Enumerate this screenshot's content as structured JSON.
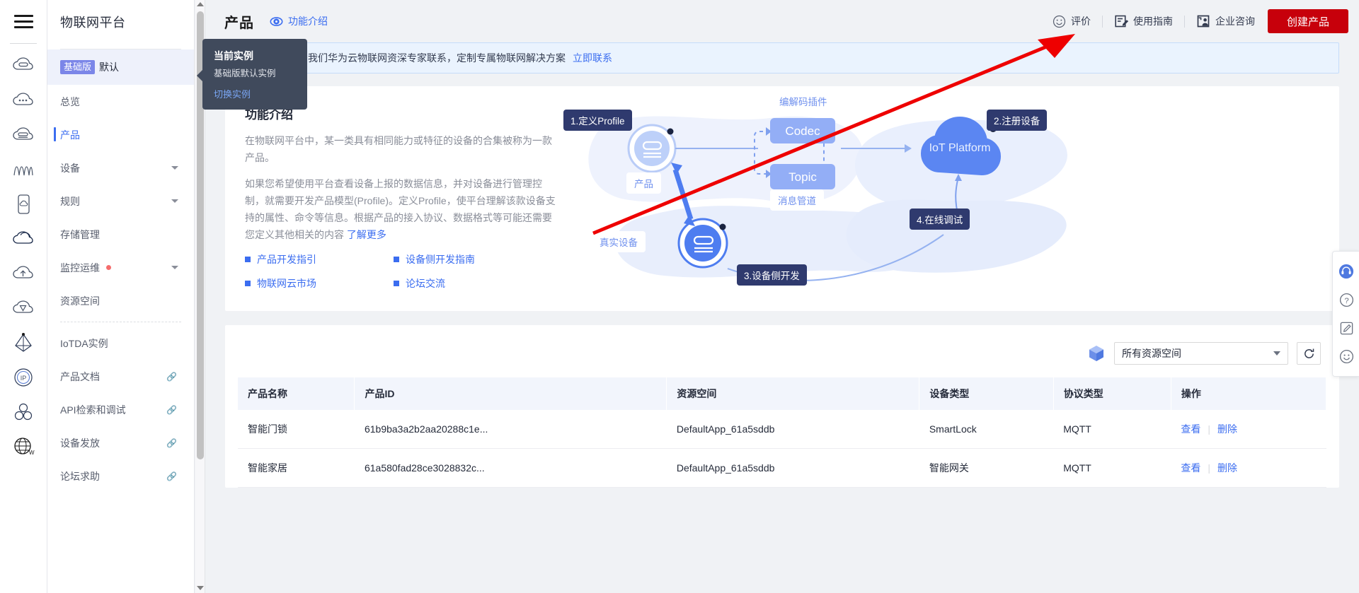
{
  "rail": {
    "menu_icon": "hamburger-menu-icon",
    "icons": [
      {
        "name": "cloud-server-icon"
      },
      {
        "name": "cloud-dots-icon"
      },
      {
        "name": "cloud-database-icon"
      },
      {
        "name": "wave-chart-icon"
      },
      {
        "name": "mobile-cloud-icon"
      },
      {
        "name": "cloud-stack-icon"
      },
      {
        "name": "cloud-upload-icon"
      },
      {
        "name": "cloud-play-icon"
      },
      {
        "name": "pyramid-icon"
      },
      {
        "name": "ip-circle-icon"
      },
      {
        "name": "molecule-icon"
      },
      {
        "name": "globe-w-icon"
      }
    ]
  },
  "sidebar": {
    "title": "物联网平台",
    "instance": {
      "badge": "基础版",
      "name": "默认"
    },
    "items": [
      {
        "label": "总览",
        "active": false,
        "caret": false,
        "dot": false,
        "external": false
      },
      {
        "label": "产品",
        "active": true,
        "caret": false,
        "dot": false,
        "external": false
      },
      {
        "label": "设备",
        "active": false,
        "caret": true,
        "dot": false,
        "external": false
      },
      {
        "label": "规则",
        "active": false,
        "caret": true,
        "dot": false,
        "external": false
      },
      {
        "label": "存储管理",
        "active": false,
        "caret": false,
        "dot": false,
        "external": false
      },
      {
        "label": "监控运维",
        "active": false,
        "caret": true,
        "dot": true,
        "external": false
      },
      {
        "label": "资源空间",
        "active": false,
        "caret": false,
        "dot": false,
        "external": false
      },
      {
        "label": "IoTDA实例",
        "active": false,
        "caret": false,
        "dot": false,
        "external": false
      },
      {
        "label": "产品文档",
        "active": false,
        "caret": false,
        "dot": false,
        "external": true
      },
      {
        "label": "API检索和调试",
        "active": false,
        "caret": false,
        "dot": false,
        "external": true
      },
      {
        "label": "设备发放",
        "active": false,
        "caret": false,
        "dot": false,
        "external": true
      },
      {
        "label": "论坛求助",
        "active": false,
        "caret": false,
        "dot": false,
        "external": true
      }
    ]
  },
  "header": {
    "title": "产品",
    "feature_link": "功能介绍",
    "actions": [
      {
        "label": "评价",
        "icon": "smiley-icon"
      },
      {
        "label": "使用指南",
        "icon": "guide-book-icon"
      },
      {
        "label": "企业咨询",
        "icon": "enterprise-consult-icon"
      }
    ],
    "create_button": "创建产品"
  },
  "notice": {
    "text": "欢迎企业客户与我们华为云物联网资深专家联系，定制专属物联网解决方案",
    "link": "立即联系"
  },
  "tooltip": {
    "title": "当前实例",
    "subtitle": "基础版默认实例",
    "action": "切换实例"
  },
  "intro": {
    "heading": "功能介绍",
    "paragraph1": "在物联网平台中，某一类具有相同能力或特征的设备的合集被称为一款产品。",
    "paragraph2": "如果您希望使用平台查看设备上报的数据信息，并对设备进行管理控制，就需要开发产品模型(Profile)。定义Profile，使平台理解该款设备支持的属性、命令等信息。根据产品的接入协议、数据格式等可能还需要您定义其他相关的内容",
    "more_link": "了解更多",
    "links": [
      {
        "label": "产品开发指引"
      },
      {
        "label": "设备侧开发指南"
      },
      {
        "label": "物联网云市场"
      },
      {
        "label": "论坛交流"
      }
    ]
  },
  "diagram": {
    "step1": "1.定义Profile",
    "step2": "2.注册设备",
    "step3": "3.设备侧开发",
    "step4": "4.在线调试",
    "label_product": "产品",
    "label_real_device": "真实设备",
    "label_codec_plugin": "编解码插件",
    "label_message_channel": "消息管道",
    "box_codec": "Codec",
    "box_topic": "Topic",
    "cloud_label": "IoT Platform"
  },
  "toolbar": {
    "space_icon": "cube-icon",
    "space_selected": "所有资源空间",
    "refresh_icon": "refresh-icon"
  },
  "table": {
    "columns": [
      "产品名称",
      "产品ID",
      "资源空间",
      "设备类型",
      "协议类型",
      "操作"
    ],
    "rows": [
      {
        "name": "智能门锁",
        "id": "61b9ba3a2b2aa20288c1e...",
        "space": "DefaultApp_61a5sddb",
        "device_type": "SmartLock",
        "protocol": "MQTT",
        "view": "查看",
        "delete": "删除"
      },
      {
        "name": "智能家居",
        "id": "61a580fad28ce3028832c...",
        "space": "DefaultApp_61a5sddb",
        "device_type": "智能网关",
        "protocol": "MQTT",
        "view": "查看",
        "delete": "删除"
      }
    ]
  },
  "dock": {
    "buttons": [
      {
        "name": "customer-service-icon"
      },
      {
        "name": "help-question-icon"
      },
      {
        "name": "feedback-edit-icon"
      },
      {
        "name": "satisfaction-smiley-icon"
      }
    ]
  },
  "colors": {
    "accent_blue": "#3b6df0",
    "brand_red": "#c7000b",
    "annotation_red": "#ee0000",
    "tooltip_bg": "#404a5c",
    "badge_purple": "#7b86e8"
  }
}
